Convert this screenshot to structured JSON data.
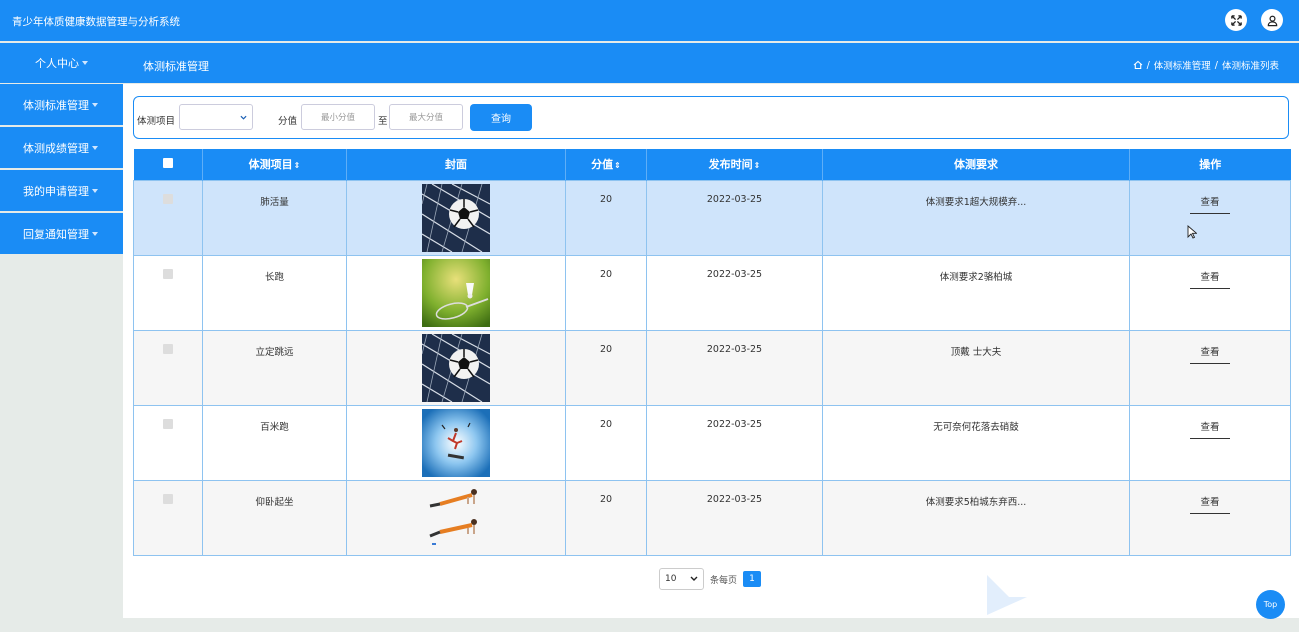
{
  "app": {
    "title": "青少年体质健康数据管理与分析系统"
  },
  "colors": {
    "primary": "#1a8cf5",
    "selected_row": "#cfe4fb"
  },
  "topbar": {
    "fullscreen_icon": "fullscreen-icon",
    "user_icon": "user-icon"
  },
  "nav": {
    "personal_center": "个人中心",
    "section_title": "体测标准管理",
    "breadcrumb": {
      "home_icon": "home-icon",
      "sep": "/",
      "level1": "体测标准管理",
      "level2": "体测标准列表"
    }
  },
  "sidebar": {
    "items": [
      {
        "label": "体测标准管理"
      },
      {
        "label": "体测成绩管理"
      },
      {
        "label": "我的申请管理"
      },
      {
        "label": "回复通知管理"
      }
    ]
  },
  "search": {
    "item_label": "体测项目",
    "item_value": "",
    "score_label": "分值",
    "min_placeholder": "最小分值",
    "to_label": "至",
    "max_placeholder": "最大分值",
    "query_button": "查询"
  },
  "table": {
    "headers": {
      "item": "体测项目",
      "cover": "封面",
      "score": "分值",
      "date": "发布时间",
      "requirement": "体测要求",
      "action": "操作"
    },
    "sort_glyph": "⇕",
    "rows": [
      {
        "item": "肺活量",
        "cover": "soccer",
        "score": "20",
        "date": "2022-03-25",
        "requirement": "体测要求1超大规模弃...",
        "action": "查看"
      },
      {
        "item": "长跑",
        "cover": "badminton",
        "score": "20",
        "date": "2022-03-25",
        "requirement": "体测要求2骆柏城",
        "action": "查看"
      },
      {
        "item": "立定跳远",
        "cover": "soccer",
        "score": "20",
        "date": "2022-03-25",
        "requirement": "顶戴 士大夫",
        "action": "查看"
      },
      {
        "item": "百米跑",
        "cover": "jump",
        "score": "20",
        "date": "2022-03-25",
        "requirement": "无可奈何花落去硝鼓",
        "action": "查看"
      },
      {
        "item": "仰卧起坐",
        "cover": "plank",
        "score": "20",
        "date": "2022-03-25",
        "requirement": "体测要求5柏城东弃西...",
        "action": "查看"
      }
    ]
  },
  "pager": {
    "page_size": "10",
    "per_page_label": "条每页",
    "current_page": "1"
  },
  "top_button": "Top"
}
